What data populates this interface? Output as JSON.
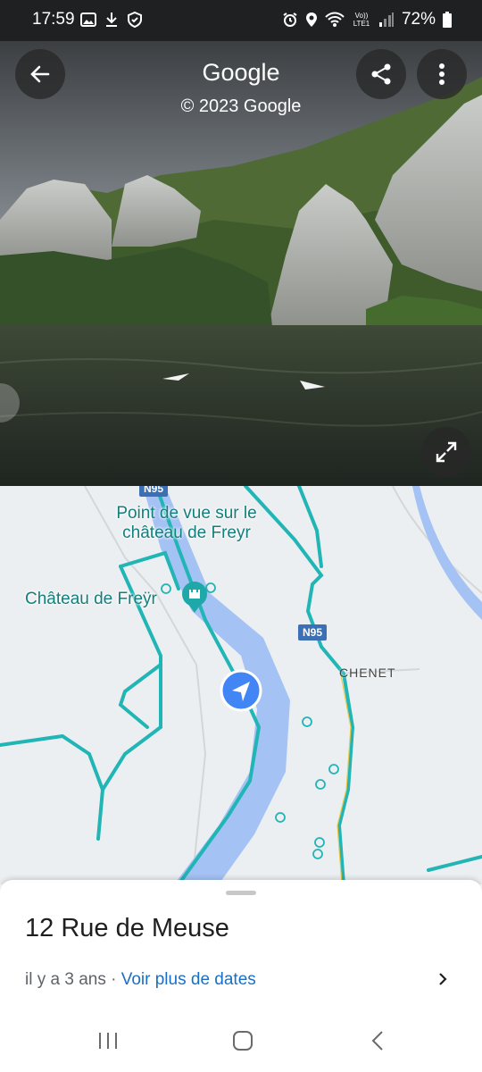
{
  "status_bar": {
    "time": "17:59",
    "battery": "72%",
    "left_icons": [
      "gallery-icon",
      "download-icon",
      "shield-icon"
    ],
    "right_icons": [
      "alarm-icon",
      "location-icon",
      "wifi-icon",
      "volte-icon",
      "signal-icon",
      "battery-icon"
    ],
    "volte_label": "Vo)) LTE1"
  },
  "street_view": {
    "title": "Google",
    "copyright": "© 2023 Google",
    "buttons": [
      "back-icon",
      "share-icon",
      "more-icon",
      "expand-icon"
    ]
  },
  "map": {
    "poi_viewpoint_line1": "Point de vue sur le",
    "poi_viewpoint_line2": "château de Freyr",
    "poi_castle": "Château de Freÿr",
    "road_n95_top": "N95",
    "road_n95": "N95",
    "town": "CHENET",
    "colors": {
      "river": "#a4c2f4",
      "road": "#21b5b5",
      "land": "#eceff1",
      "location": "#4285f4"
    }
  },
  "sheet": {
    "address": "12 Rue de Meuse",
    "date_text": "il y a 3 ans · ",
    "more_dates_link": "Voir plus de dates"
  },
  "nav_bar": {
    "buttons": [
      "recents-icon",
      "home-icon",
      "back-nav-icon"
    ]
  }
}
